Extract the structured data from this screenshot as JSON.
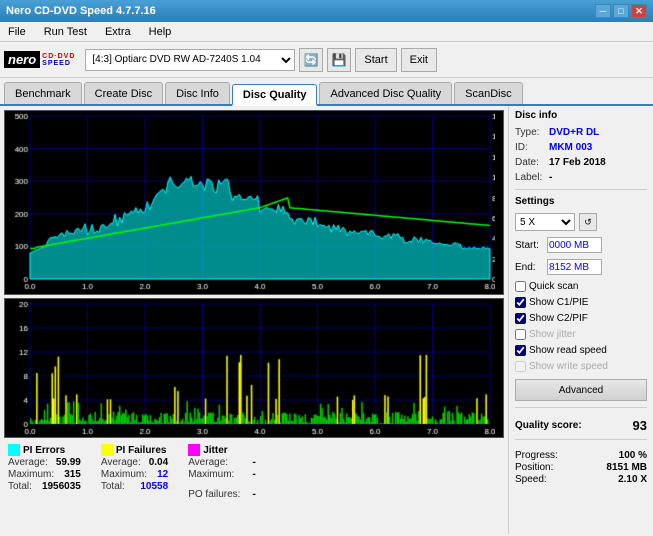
{
  "titlebar": {
    "title": "Nero CD-DVD Speed 4.7.7.16",
    "minimize": "─",
    "maximize": "□",
    "close": "✕"
  },
  "menubar": {
    "items": [
      "File",
      "Run Test",
      "Extra",
      "Help"
    ]
  },
  "toolbar": {
    "drive_label": "[4:3]  Optiarc DVD RW AD-7240S 1.04",
    "start_label": "Start",
    "exit_label": "Exit"
  },
  "tabs": [
    {
      "label": "Benchmark",
      "active": false
    },
    {
      "label": "Create Disc",
      "active": false
    },
    {
      "label": "Disc Info",
      "active": false
    },
    {
      "label": "Disc Quality",
      "active": true
    },
    {
      "label": "Advanced Disc Quality",
      "active": false
    },
    {
      "label": "ScanDisc",
      "active": false
    }
  ],
  "disc_info": {
    "section_title": "Disc info",
    "type_label": "Type:",
    "type_value": "DVD+R DL",
    "id_label": "ID:",
    "id_value": "MKM 003",
    "date_label": "Date:",
    "date_value": "17 Feb 2018",
    "label_label": "Label:",
    "label_value": "-"
  },
  "settings": {
    "section_title": "Settings",
    "speed_value": "5 X",
    "start_label": "Start:",
    "start_value": "0000 MB",
    "end_label": "End:",
    "end_value": "8152 MB",
    "quick_scan_label": "Quick scan",
    "quick_scan_checked": false,
    "c1pie_label": "Show C1/PIE",
    "c1pie_checked": true,
    "c2pif_label": "Show C2/PIF",
    "c2pif_checked": true,
    "jitter_label": "Show jitter",
    "jitter_checked": false,
    "read_speed_label": "Show read speed",
    "read_speed_checked": true,
    "write_speed_label": "Show write speed",
    "write_speed_checked": false,
    "advanced_label": "Advanced"
  },
  "quality": {
    "score_label": "Quality score:",
    "score_value": "93"
  },
  "progress": {
    "progress_label": "Progress:",
    "progress_value": "100 %",
    "position_label": "Position:",
    "position_value": "8151 MB",
    "speed_label": "Speed:",
    "speed_value": "2.10 X"
  },
  "legend": {
    "pi_errors": {
      "title": "PI Errors",
      "color": "#00ffff",
      "avg_label": "Average:",
      "avg_value": "59.99",
      "max_label": "Maximum:",
      "max_value": "315",
      "total_label": "Total:",
      "total_value": "1956035"
    },
    "pi_failures": {
      "title": "PI Failures",
      "color": "#ffff00",
      "avg_label": "Average:",
      "avg_value": "0.04",
      "max_label": "Maximum:",
      "max_value": "12",
      "total_label": "Total:",
      "total_value": "10558"
    },
    "jitter": {
      "title": "Jitter",
      "color": "#ff00ff",
      "avg_label": "Average:",
      "avg_value": "-",
      "max_label": "Maximum:",
      "max_value": "-"
    },
    "po_failures": {
      "label": "PO failures:",
      "value": "-"
    }
  }
}
